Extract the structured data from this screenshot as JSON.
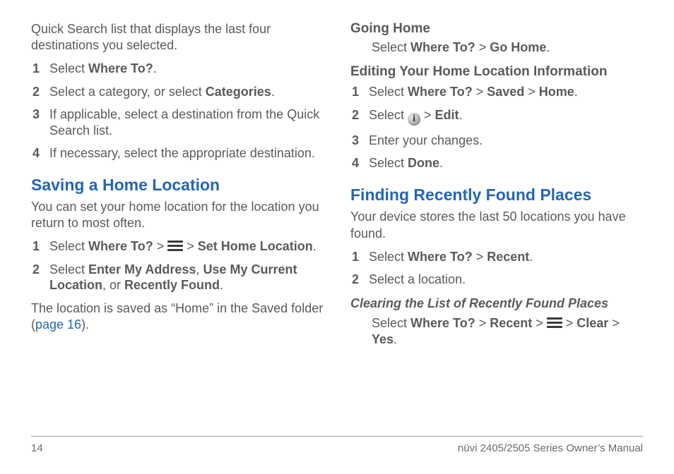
{
  "left": {
    "lead": "Quick Search list that displays the last four destinations you selected.",
    "steps1": {
      "n1": "1",
      "t1a": "Select ",
      "t1b": "Where To?",
      "t1c": ".",
      "n2": "2",
      "t2a": "Select a category, or select ",
      "t2b": "Categories",
      "t2c": ".",
      "n3": "3",
      "t3": "If applicable, select a destination from the Quick Search list.",
      "n4": "4",
      "t4": "If necessary, select the appropriate destination."
    },
    "h2": "Saving a Home Location",
    "intro2": "You can set your home location for the location you return to most often.",
    "steps2": {
      "n1": "1",
      "s1a": "Select ",
      "s1b": "Where To?",
      "s1c": " > ",
      "s1d": " > ",
      "s1e": "Set Home Location",
      "s1f": ".",
      "n2": "2",
      "s2a": "Select ",
      "s2b": "Enter My Address",
      "s2c": ", ",
      "s2d": "Use My Current Location",
      "s2e": ", or ",
      "s2f": "Recently Found",
      "s2g": "."
    },
    "tail_a": "The location is saved as “Home” in the Saved folder (",
    "tail_link": "page 16",
    "tail_b": ")."
  },
  "right": {
    "h3a": "Going Home",
    "gh_a": "Select ",
    "gh_b": "Where To?",
    "gh_c": " > ",
    "gh_d": "Go Home",
    "gh_e": ".",
    "h3b": "Editing Your Home Location Information",
    "steps3": {
      "n1": "1",
      "a1": "Select ",
      "b1": "Where To?",
      "c1": " > ",
      "d1": "Saved",
      "e1": " > ",
      "f1": "Home",
      "g1": ".",
      "n2": "2",
      "a2": "Select ",
      "c2": " > ",
      "d2": "Edit",
      "e2": ".",
      "n3": "3",
      "t3": "Enter your changes.",
      "n4": "4",
      "a4": "Select ",
      "b4": "Done",
      "c4": "."
    },
    "h2": "Finding Recently Found Places",
    "intro": "Your device stores the last 50 locations you have found.",
    "steps4": {
      "n1": "1",
      "a1": "Select ",
      "b1": "Where To?",
      "c1": " > ",
      "d1": "Recent",
      "e1": ".",
      "n2": "2",
      "t2": "Select a location."
    },
    "h4": "Clearing the List of Recently Found Places",
    "clr_a": "Select ",
    "clr_b": "Where To?",
    "clr_c": " > ",
    "clr_d": "Recent",
    "clr_e": " > ",
    "clr_f": " > ",
    "clr_g": "Clear",
    "clr_h": " > ",
    "clr_i": "Yes",
    "clr_j": "."
  },
  "footer": {
    "page": "14",
    "title": "nüvi 2405/2505 Series Owner’s Manual"
  },
  "icons": {
    "info": "i"
  }
}
